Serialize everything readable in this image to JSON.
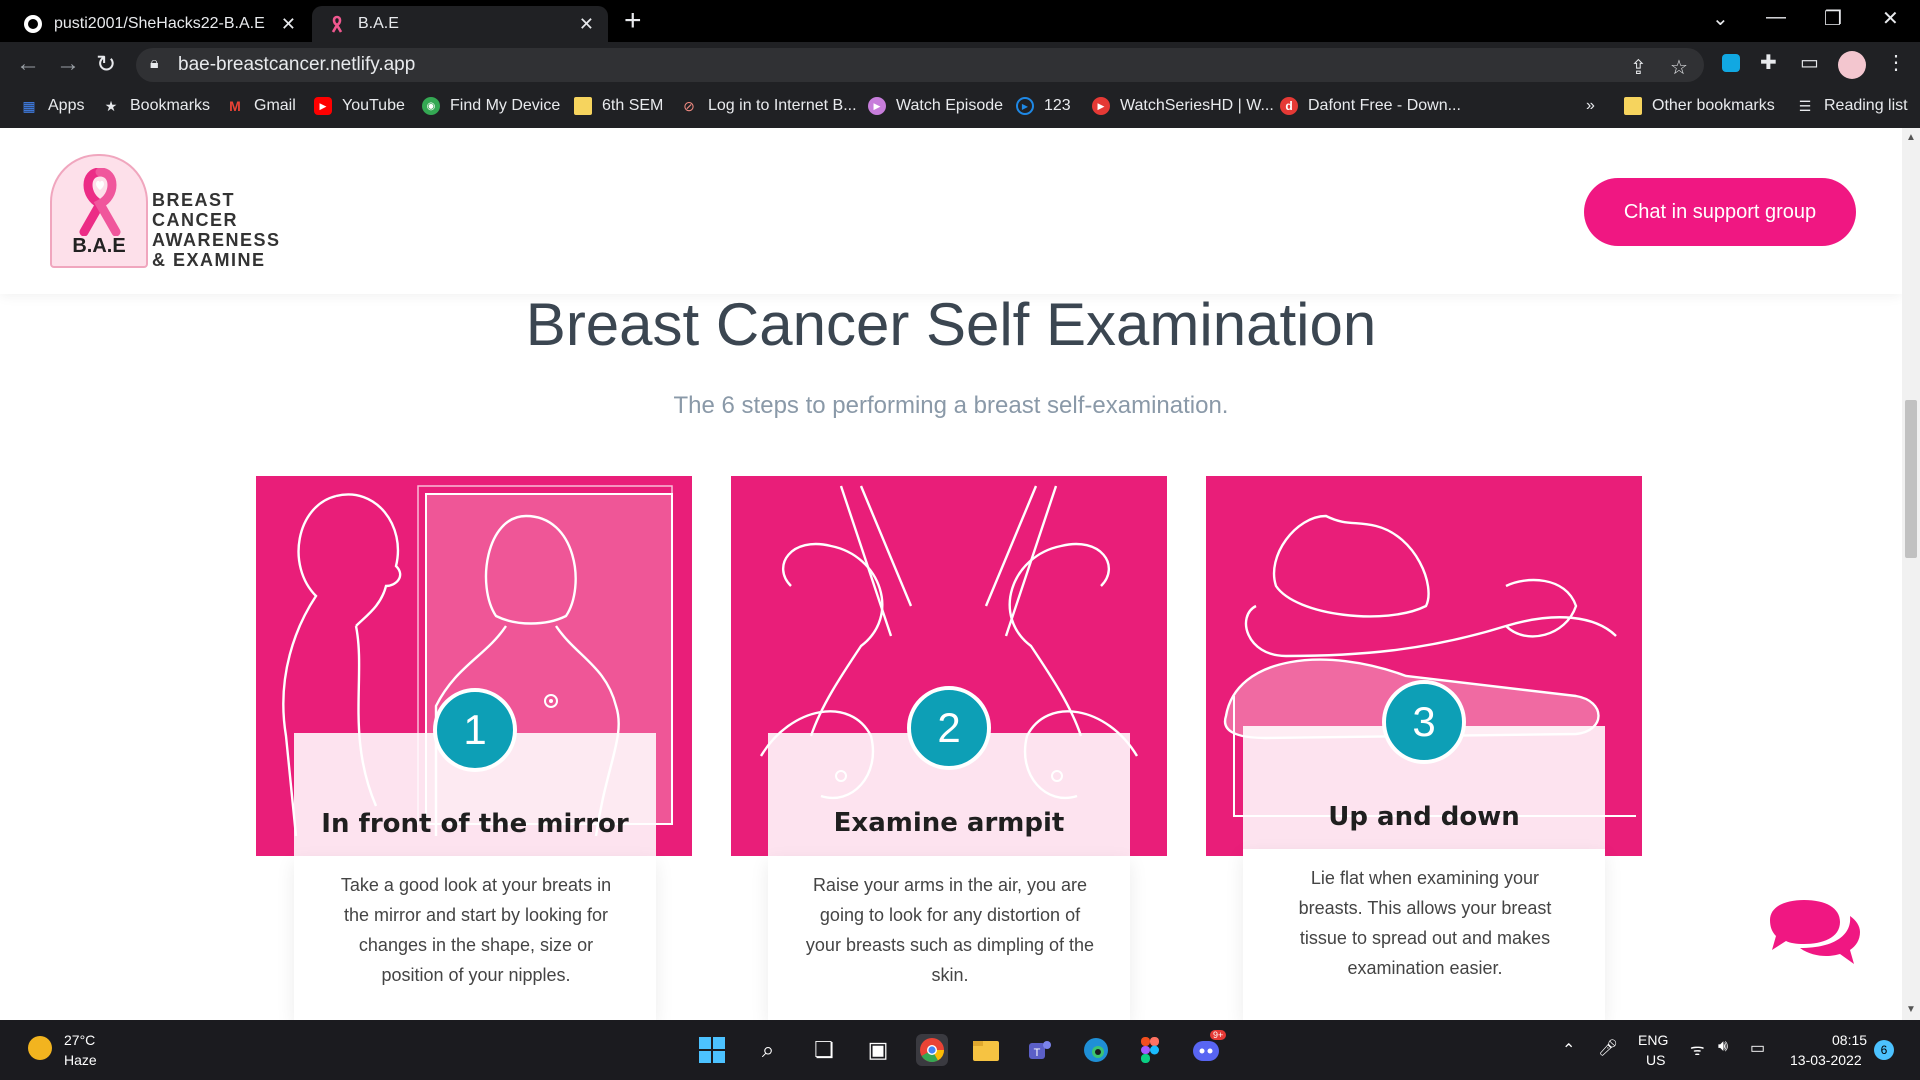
{
  "browser": {
    "tabs": [
      {
        "title": "pusti2001/SheHacks22-B.A.E",
        "active": false
      },
      {
        "title": "B.A.E",
        "active": true
      }
    ],
    "url": "bae-breastcancer.netlify.app",
    "bookmarks": [
      {
        "label": "Apps",
        "icon": "apps-grid-icon"
      },
      {
        "label": "Bookmarks",
        "icon": "star-icon"
      },
      {
        "label": "Gmail",
        "icon": "gmail-icon"
      },
      {
        "label": "YouTube",
        "icon": "youtube-icon"
      },
      {
        "label": "Find My Device",
        "icon": "find-device-icon"
      },
      {
        "label": "6th SEM",
        "icon": "folder-icon"
      },
      {
        "label": "Log in to Internet B...",
        "icon": "internet-icon"
      },
      {
        "label": "Watch Episode",
        "icon": "play-icon"
      },
      {
        "label": "123",
        "icon": "play-circle-icon"
      },
      {
        "label": "WatchSeriesHD | W...",
        "icon": "play-red-icon"
      },
      {
        "label": "Dafont Free - Down...",
        "icon": "dafont-icon"
      }
    ],
    "bookmarks_overflow": "»",
    "other_bookmarks": "Other bookmarks",
    "reading_list": "Reading list"
  },
  "site": {
    "logo": {
      "abbr": "B.A.E",
      "lines": [
        "BREAST",
        "CANCER",
        "AWARENESS",
        "& EXAMINE"
      ]
    },
    "chat_button": "Chat in support group",
    "title": "Breast Cancer Self Examination",
    "subtitle": "The 6 steps to performing a breast self-examination.",
    "steps": [
      {
        "number": "1",
        "title": "In front of the mirror",
        "desc": "Take a good look at your breats in the mirror and start by looking for changes in the shape, size or position of your nipples."
      },
      {
        "number": "2",
        "title": "Examine armpit",
        "desc": "Raise your arms in the air, you are going to look for any distortion of your breasts such as dimpling of the skin."
      },
      {
        "number": "3",
        "title": "Up and down",
        "desc": "Lie flat when examining your breasts. This allows your breast tissue to spread out and makes examination easier."
      }
    ],
    "colors": {
      "accent": "#e91e79",
      "button": "#f01782",
      "badge": "#0d9fb6"
    }
  },
  "taskbar": {
    "weather_temp": "27°C",
    "weather_cond": "Haze",
    "lang_top": "ENG",
    "lang_bottom": "US",
    "time": "08:15",
    "date": "13-03-2022",
    "notifications": "6",
    "discord_badge": "9+"
  }
}
